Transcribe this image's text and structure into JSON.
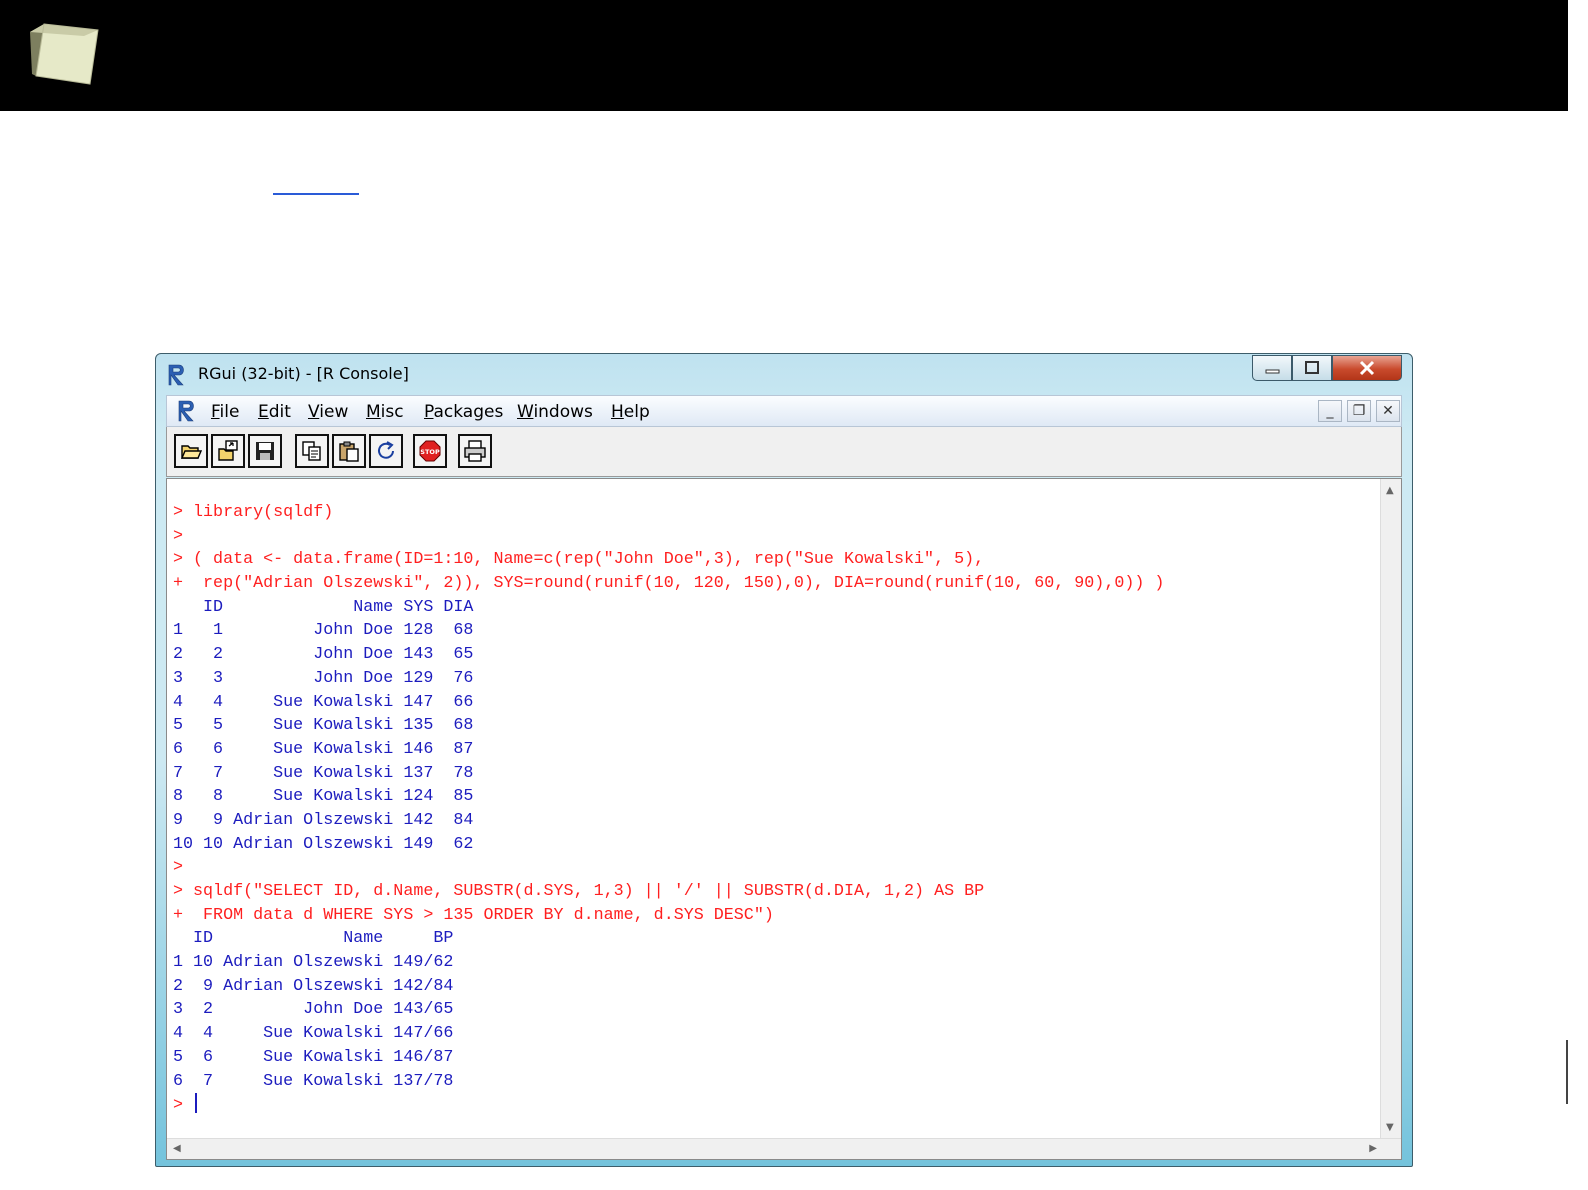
{
  "window": {
    "title": "RGui (32-bit) - [R Console]",
    "icon": "r-logo-icon"
  },
  "menu": {
    "items": [
      "File",
      "Edit",
      "View",
      "Misc",
      "Packages",
      "Windows",
      "Help"
    ]
  },
  "toolbar": {
    "buttons": [
      {
        "icon": "open-script-icon"
      },
      {
        "icon": "load-workspace-icon"
      },
      {
        "icon": "save-icon"
      },
      {
        "icon": "copy-icon"
      },
      {
        "icon": "paste-icon"
      },
      {
        "icon": "copy-paste-icon"
      },
      {
        "icon": "stop-icon",
        "label": "STOP"
      },
      {
        "icon": "print-icon"
      }
    ]
  },
  "console": {
    "lines": [
      {
        "kind": "in",
        "text": "> library(sqldf)"
      },
      {
        "kind": "in",
        "text": ">"
      },
      {
        "kind": "in",
        "text": "> ( data <- data.frame(ID=1:10, Name=c(rep(\"John Doe\",3), rep(\"Sue Kowalski\", 5),"
      },
      {
        "kind": "in",
        "text": "+  rep(\"Adrian Olszewski\", 2)), SYS=round(runif(10, 120, 150),0), DIA=round(runif(10, 60, 90),0)) )"
      },
      {
        "kind": "out",
        "text": "   ID             Name SYS DIA"
      },
      {
        "kind": "out",
        "text": "1   1         John Doe 128  68"
      },
      {
        "kind": "out",
        "text": "2   2         John Doe 143  65"
      },
      {
        "kind": "out",
        "text": "3   3         John Doe 129  76"
      },
      {
        "kind": "out",
        "text": "4   4     Sue Kowalski 147  66"
      },
      {
        "kind": "out",
        "text": "5   5     Sue Kowalski 135  68"
      },
      {
        "kind": "out",
        "text": "6   6     Sue Kowalski 146  87"
      },
      {
        "kind": "out",
        "text": "7   7     Sue Kowalski 137  78"
      },
      {
        "kind": "out",
        "text": "8   8     Sue Kowalski 124  85"
      },
      {
        "kind": "out",
        "text": "9   9 Adrian Olszewski 142  84"
      },
      {
        "kind": "out",
        "text": "10 10 Adrian Olszewski 149  62"
      },
      {
        "kind": "in",
        "text": ">"
      },
      {
        "kind": "in",
        "text": "> sqldf(\"SELECT ID, d.Name, SUBSTR(d.SYS, 1,3) || '/' || SUBSTR(d.DIA, 1,2) AS BP"
      },
      {
        "kind": "in",
        "text": "+  FROM data d WHERE SYS > 135 ORDER BY d.name, d.SYS DESC\")"
      },
      {
        "kind": "out",
        "text": "  ID             Name     BP"
      },
      {
        "kind": "out",
        "text": "1 10 Adrian Olszewski 149/62"
      },
      {
        "kind": "out",
        "text": "2  9 Adrian Olszewski 142/84"
      },
      {
        "kind": "out",
        "text": "3  2         John Doe 143/65"
      },
      {
        "kind": "out",
        "text": "4  4     Sue Kowalski 147/66"
      },
      {
        "kind": "out",
        "text": "5  6     Sue Kowalski 146/87"
      },
      {
        "kind": "out",
        "text": "6  7     Sue Kowalski 137/78"
      }
    ],
    "prompt": ">"
  },
  "colors": {
    "input": "#ff1f1f",
    "output": "#1c1cbe",
    "header": "#000000"
  }
}
